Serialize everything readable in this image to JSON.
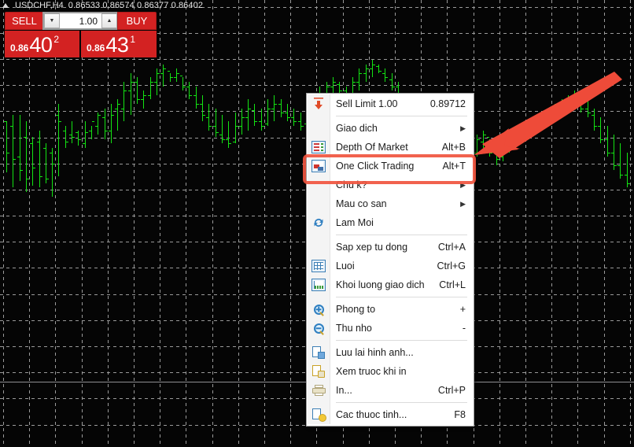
{
  "symbol_bar": {
    "icon": "triangle-up-icon",
    "symbol": "USDCHF,H4",
    "open": "0.86533",
    "high": "0.86574",
    "low": "0.86377",
    "close": "0.86402",
    "ohlc_line": "0.86533 0.86574 0.86377 0.86402"
  },
  "one_click_panel": {
    "sell_label": "SELL",
    "buy_label": "BUY",
    "volume": "1.00",
    "volume_down_icon": "chevron-down-icon",
    "volume_up_icon": "chevron-up-icon",
    "sell_price": {
      "prefix": "0.86",
      "big": "40",
      "sup": "2"
    },
    "buy_price": {
      "prefix": "0.86",
      "big": "43",
      "sup": "1"
    }
  },
  "context_menu": {
    "items": [
      {
        "id": "sell-limit",
        "icon": "arrow-down-icon",
        "label": "Sell Limit 1.00",
        "accel": "0.89712",
        "submenu": false,
        "sep_after": true
      },
      {
        "id": "giao-dich",
        "icon": "",
        "label": "Giao dich",
        "accel": "",
        "submenu": true,
        "sep_after": false
      },
      {
        "id": "depth-of-market",
        "icon": "depth-of-market-icon",
        "label": "Depth Of Market",
        "accel": "Alt+B",
        "submenu": false,
        "sep_after": false
      },
      {
        "id": "one-click-trading",
        "icon": "one-click-trading-icon",
        "label": "One Click Trading",
        "accel": "Alt+T",
        "submenu": false,
        "sep_after": false,
        "highlighted": true
      },
      {
        "id": "chu-ky",
        "icon": "",
        "label": "Chu k?",
        "accel": "",
        "submenu": true,
        "sep_after": false
      },
      {
        "id": "mau-co-san",
        "icon": "",
        "label": "Mau co san",
        "accel": "",
        "submenu": true,
        "sep_after": false
      },
      {
        "id": "lam-moi",
        "icon": "refresh-icon",
        "label": "Lam Moi",
        "accel": "",
        "submenu": false,
        "sep_after": true
      },
      {
        "id": "sap-xep-tu-dong",
        "icon": "",
        "label": "Sap xep tu dong",
        "accel": "Ctrl+A",
        "submenu": false,
        "sep_after": false
      },
      {
        "id": "luoi",
        "icon": "grid-icon",
        "label": "Luoi",
        "accel": "Ctrl+G",
        "submenu": false,
        "sep_after": false
      },
      {
        "id": "khoi-luong-giao-dich",
        "icon": "volume-chart-icon",
        "label": "Khoi luong giao dich",
        "accel": "Ctrl+L",
        "submenu": false,
        "sep_after": true
      },
      {
        "id": "phong-to",
        "icon": "zoom-in-icon",
        "label": "Phong to",
        "accel": "+",
        "submenu": false,
        "sep_after": false
      },
      {
        "id": "thu-nho",
        "icon": "zoom-out-icon",
        "label": "Thu nho",
        "accel": "-",
        "submenu": false,
        "sep_after": true
      },
      {
        "id": "luu-lai-hinh-anh",
        "icon": "save-image-icon",
        "label": "Luu lai hinh anh...",
        "accel": "",
        "submenu": false,
        "sep_after": false
      },
      {
        "id": "xem-truoc-khi-in",
        "icon": "print-preview-icon",
        "label": "Xem truoc khi in",
        "accel": "",
        "submenu": false,
        "sep_after": false
      },
      {
        "id": "in",
        "icon": "printer-icon",
        "label": "In...",
        "accel": "Ctrl+P",
        "submenu": false,
        "sep_after": true
      },
      {
        "id": "cac-thuoc-tinh",
        "icon": "properties-icon",
        "label": "Cac thuoc tinh...",
        "accel": "F8",
        "submenu": false,
        "sep_after": false
      }
    ]
  },
  "annotations": {
    "highlight_color": "#f0553f",
    "arrow_color": "#ee4b39",
    "arrow_name": "pointer-arrow",
    "highlight_target": "One Click Trading"
  },
  "colors": {
    "chart_background": "#050505",
    "grid": "#9a9a9a",
    "bar_bullish": "#13e413",
    "panel_red": "#d32222",
    "menu_background": "#ffffff"
  },
  "chart_data": {
    "type": "ohlc-bar",
    "title": "USDCHF,H4",
    "xlabel": "",
    "ylabel": "",
    "bar_color": "#13e413",
    "background": "#050505",
    "grid": true,
    "bars": [
      [
        52,
        29,
        52,
        38
      ],
      [
        55,
        22,
        50,
        35
      ],
      [
        55,
        25,
        36,
        30
      ],
      [
        52,
        20,
        45,
        26
      ],
      [
        45,
        23,
        42,
        31
      ],
      [
        48,
        22,
        43,
        27
      ],
      [
        42,
        24,
        40,
        26
      ],
      [
        40,
        18,
        38,
        33
      ],
      [
        60,
        27,
        55,
        52
      ],
      [
        50,
        40,
        48,
        43
      ],
      [
        52,
        42,
        46,
        45
      ],
      [
        48,
        41,
        47,
        44
      ],
      [
        52,
        40,
        42,
        47
      ],
      [
        50,
        44,
        48,
        52
      ],
      [
        56,
        46,
        50,
        55
      ],
      [
        58,
        44,
        54,
        48
      ],
      [
        60,
        42,
        48,
        55
      ],
      [
        62,
        48,
        58,
        60
      ],
      [
        70,
        52,
        58,
        66
      ],
      [
        74,
        55,
        66,
        70
      ],
      [
        72,
        60,
        70,
        62
      ],
      [
        66,
        58,
        62,
        64
      ],
      [
        72,
        62,
        64,
        70
      ],
      [
        76,
        64,
        70,
        74
      ],
      [
        78,
        68,
        74,
        76
      ],
      [
        74,
        70,
        75,
        72
      ],
      [
        76,
        70,
        72,
        74
      ],
      [
        72,
        66,
        73,
        68
      ],
      [
        70,
        62,
        68,
        64
      ],
      [
        68,
        58,
        64,
        60
      ],
      [
        64,
        52,
        60,
        55
      ],
      [
        60,
        48,
        54,
        50
      ],
      [
        58,
        45,
        50,
        47
      ],
      [
        55,
        42,
        46,
        44
      ],
      [
        52,
        40,
        44,
        42
      ],
      [
        56,
        42,
        43,
        50
      ],
      [
        58,
        46,
        50,
        54
      ],
      [
        62,
        48,
        54,
        58
      ],
      [
        60,
        50,
        57,
        52
      ],
      [
        58,
        48,
        52,
        50
      ],
      [
        62,
        50,
        51,
        58
      ],
      [
        64,
        52,
        58,
        60
      ],
      [
        62,
        54,
        60,
        56
      ],
      [
        60,
        52,
        56,
        54
      ],
      [
        58,
        50,
        54,
        52
      ],
      [
        56,
        48,
        52,
        50
      ],
      [
        60,
        50,
        51,
        56
      ],
      [
        64,
        54,
        56,
        62
      ],
      [
        68,
        58,
        62,
        65
      ],
      [
        70,
        60,
        64,
        68
      ],
      [
        72,
        62,
        68,
        70
      ],
      [
        70,
        64,
        69,
        66
      ],
      [
        68,
        60,
        66,
        62
      ],
      [
        72,
        62,
        63,
        70
      ],
      [
        76,
        66,
        70,
        74
      ],
      [
        78,
        70,
        74,
        76
      ],
      [
        80,
        72,
        76,
        78
      ],
      [
        78,
        74,
        77,
        75
      ],
      [
        76,
        70,
        74,
        72
      ],
      [
        74,
        66,
        71,
        68
      ],
      [
        70,
        30,
        68,
        34
      ],
      [
        48,
        28,
        34,
        44
      ],
      [
        52,
        38,
        44,
        40
      ],
      [
        56,
        40,
        42,
        52
      ],
      [
        54,
        44,
        50,
        46
      ],
      [
        50,
        42,
        46,
        44
      ],
      [
        52,
        40,
        44,
        48
      ],
      [
        48,
        38,
        46,
        42
      ],
      [
        46,
        36,
        42,
        40
      ],
      [
        50,
        38,
        40,
        46
      ],
      [
        48,
        40,
        45,
        42
      ],
      [
        44,
        34,
        42,
        38
      ],
      [
        46,
        36,
        38,
        44
      ],
      [
        48,
        40,
        43,
        46
      ],
      [
        44,
        36,
        45,
        38
      ],
      [
        40,
        32,
        38,
        35
      ],
      [
        44,
        34,
        36,
        42
      ],
      [
        46,
        38,
        42,
        44
      ],
      [
        48,
        40,
        43,
        46
      ],
      [
        50,
        42,
        45,
        48
      ],
      [
        52,
        44,
        47,
        50
      ],
      [
        54,
        46,
        49,
        52
      ],
      [
        56,
        48,
        51,
        54
      ],
      [
        58,
        50,
        53,
        56
      ],
      [
        60,
        52,
        55,
        58
      ],
      [
        62,
        54,
        57,
        60
      ],
      [
        64,
        56,
        59,
        62
      ],
      [
        66,
        58,
        61,
        64
      ],
      [
        64,
        56,
        62,
        58
      ],
      [
        62,
        54,
        58,
        56
      ],
      [
        58,
        48,
        55,
        50
      ],
      [
        54,
        42,
        50,
        44
      ],
      [
        50,
        36,
        44,
        38
      ],
      [
        46,
        30,
        38,
        32
      ],
      [
        42,
        26,
        32,
        28
      ],
      [
        38,
        22,
        28,
        24
      ]
    ]
  }
}
